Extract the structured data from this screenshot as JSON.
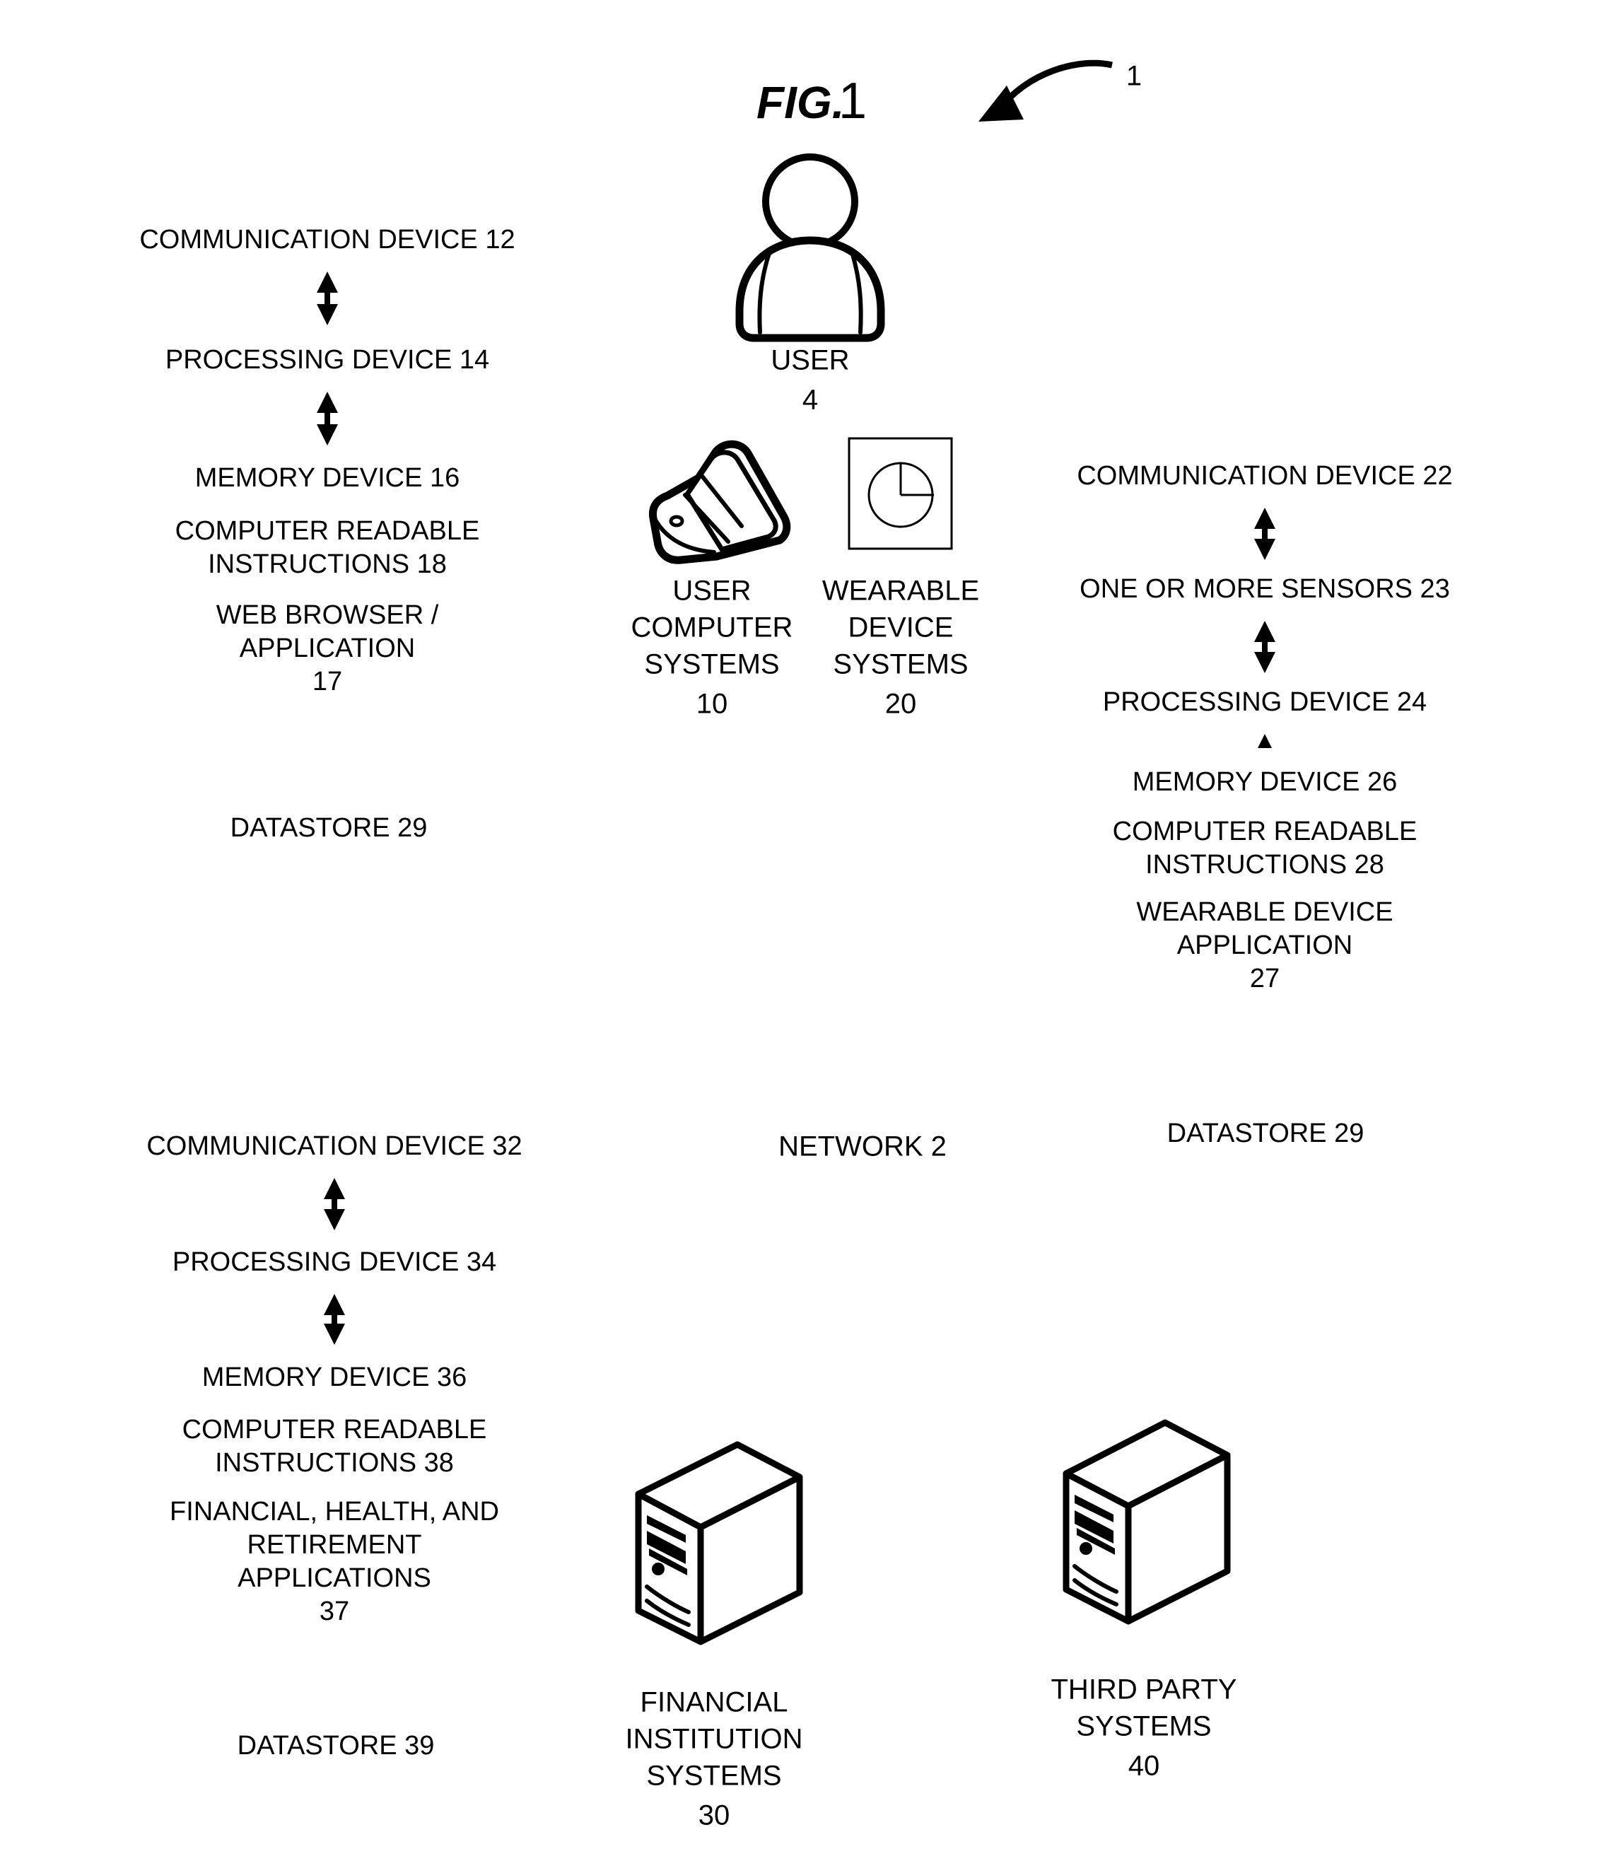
{
  "figure": {
    "label": "FIG.",
    "number": "1",
    "system_ref": "1"
  },
  "user": {
    "icon": "user-person-icon",
    "label": "USER",
    "ref": "4"
  },
  "user_computer_systems": {
    "icon": "flip-phone-icon",
    "line1": "USER",
    "line2": "COMPUTER",
    "line3": "SYSTEMS",
    "ref": "10"
  },
  "wearable_device_systems": {
    "icon": "smartwatch-face-icon",
    "line1": "WEARABLE",
    "line2": "DEVICE",
    "line3": "SYSTEMS",
    "ref": "20"
  },
  "network": {
    "icon": "cloud-icon",
    "label": "NETWORK 2"
  },
  "financial_institution_systems": {
    "icon": "server-tower-icon",
    "line1": "FINANCIAL",
    "line2": "INSTITUTION",
    "line3": "SYSTEMS",
    "ref": "30"
  },
  "third_party_systems": {
    "icon": "server-tower-icon",
    "line1": "THIRD PARTY",
    "line2": "SYSTEMS",
    "ref": "40"
  },
  "user_computer_block": {
    "communication_device": "COMMUNICATION DEVICE 12",
    "processing_device": "PROCESSING DEVICE 14",
    "memory_device": "MEMORY DEVICE 16",
    "instructions_line1": "COMPUTER READABLE",
    "instructions_line2": "INSTRUCTIONS 18",
    "application_line1": "WEB BROWSER /",
    "application_line2": "APPLICATION",
    "application_ref": "17",
    "datastore": "DATASTORE 29"
  },
  "wearable_device_block": {
    "communication_device": "COMMUNICATION DEVICE 22",
    "sensors": "ONE OR MORE SENSORS 23",
    "processing_device": "PROCESSING DEVICE 24",
    "memory_device": "MEMORY DEVICE 26",
    "instructions_line1": "COMPUTER READABLE",
    "instructions_line2": "INSTRUCTIONS 28",
    "application_line1": "WEARABLE DEVICE",
    "application_line2": "APPLICATION",
    "application_ref": "27",
    "datastore": "DATASTORE 29"
  },
  "financial_institution_block": {
    "communication_device": "COMMUNICATION DEVICE 32",
    "processing_device": "PROCESSING DEVICE 34",
    "memory_device": "MEMORY DEVICE 36",
    "instructions_line1": "COMPUTER READABLE",
    "instructions_line2": "INSTRUCTIONS 38",
    "application_line1": "FINANCIAL, HEALTH, AND",
    "application_line2": "RETIREMENT",
    "application_line3": "APPLICATIONS",
    "application_ref": "37",
    "datastore": "DATASTORE 39"
  },
  "colors": {
    "ink": "#000000",
    "paper": "#ffffff"
  }
}
